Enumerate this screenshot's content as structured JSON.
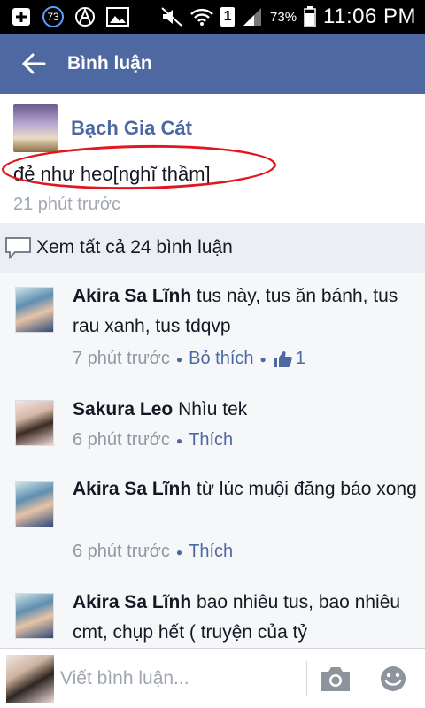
{
  "status_bar": {
    "notification_count": "73",
    "sim": "1",
    "battery": "73%",
    "time": "11:06 PM"
  },
  "header": {
    "title": "Bình luận"
  },
  "post": {
    "author": "Bạch Gia Cát",
    "text": "đẻ như heo[nghĩ thầm]",
    "time": "21 phút trước"
  },
  "view_all": "Xem tất cả 24 bình luận",
  "comments": [
    {
      "author": "Akira Sa Lĩnh",
      "text": "tus này, tus ăn bánh, tus rau xanh, tus tdqvp",
      "time": "7 phút trước",
      "action": "Bỏ thích",
      "likes": "1"
    },
    {
      "author": "Sakura Leo",
      "text": "Nhìu tek",
      "time": "6 phút trước",
      "action": "Thích"
    },
    {
      "author": "Akira Sa Lĩnh",
      "text": "từ lúc muội đăng báo xong",
      "time": "6 phút trước",
      "action": "Thích"
    },
    {
      "author": "Akira Sa Lĩnh",
      "text": "bao nhiêu tus, bao nhiêu cmt, chụp hết ( truyện của tỷ"
    }
  ],
  "composer": {
    "placeholder": "Viết bình luận..."
  },
  "colors": {
    "header_bg": "#4e69a2",
    "link": "#4e69a2",
    "highlight": "#e3161f"
  },
  "icons": [
    "plus-box-icon",
    "anarchy-icon",
    "image-icon",
    "mute-icon",
    "wifi-icon",
    "signal-icon",
    "battery-icon",
    "back-arrow-icon",
    "comment-bubble-icon",
    "thumbs-up-icon",
    "camera-icon",
    "emoji-icon"
  ]
}
